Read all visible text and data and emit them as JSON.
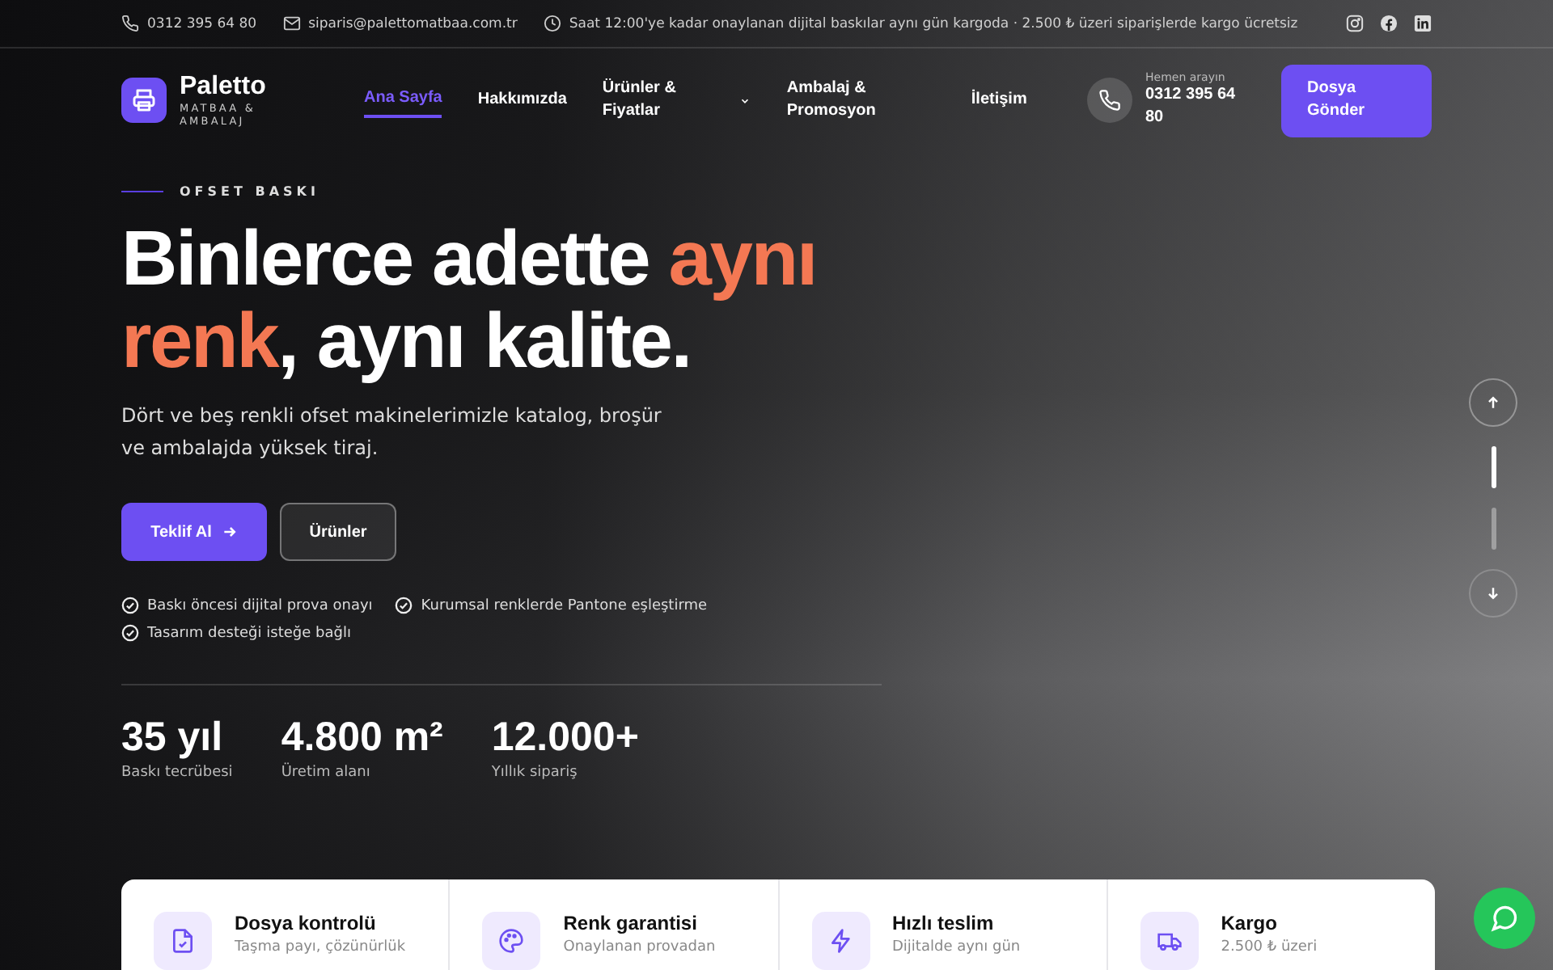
{
  "topbar": {
    "phone": "0312 395 64 80",
    "email": "siparis@palettomatbaa.com.tr",
    "notice": "Saat 12:00'ye kadar onaylanan dijital baskılar aynı gün kargoda · 2.500 ₺ üzeri siparişlerde kargo ücretsiz"
  },
  "brand": {
    "name": "Paletto",
    "tagline": "MATBAA & AMBALAJ"
  },
  "nav": [
    {
      "label": "Ana Sayfa",
      "selected": true,
      "dropdown": false
    },
    {
      "label": "Hakkımızda",
      "selected": false,
      "dropdown": false
    },
    {
      "label": "Ürünler & Fiyatlar",
      "selected": false,
      "dropdown": true
    },
    {
      "label": "Ambalaj & Promosyon",
      "selected": false,
      "dropdown": false
    },
    {
      "label": "İletişim",
      "selected": false,
      "dropdown": false
    }
  ],
  "call": {
    "hint": "Hemen arayın",
    "number": "0312 395 64 80"
  },
  "cta": "Dosya Gönder",
  "hero": {
    "eyebrow": "OFSET BASKI",
    "title": [
      {
        "text": "Binlerce adette ",
        "accent": false
      },
      {
        "text": "aynı renk",
        "accent": true
      },
      {
        "text": ", aynı kalite.",
        "accent": false
      }
    ],
    "lead": "Dört ve beş renkli ofset makinelerimizle katalog, broşür ve ambalajda yüksek tiraj.",
    "primary": "Teklif Al",
    "secondary": "Ürünler",
    "checks": [
      "Baskı öncesi dijital prova onayı",
      "Kurumsal renklerde Pantone eşleştirme",
      "Tasarım desteği isteğe bağlı"
    ]
  },
  "stats": [
    {
      "value": "35 yıl",
      "label": "Baskı tecrübesi"
    },
    {
      "value": "4.800 m²",
      "label": "Üretim alanı"
    },
    {
      "value": "12.000+",
      "label": "Yıllık sipariş"
    }
  ],
  "slides": [
    {
      "selected": true
    },
    {
      "selected": false
    }
  ],
  "features": [
    {
      "kind": "file",
      "title": "Dosya kontrolü",
      "text": "Taşma payı, çözünürlük"
    },
    {
      "kind": "palette",
      "title": "Renk garantisi",
      "text": "Onaylanan provadan"
    },
    {
      "kind": "bolt",
      "title": "Hızlı teslim",
      "text": "Dijitalde aynı gün"
    },
    {
      "kind": "truck",
      "title": "Kargo",
      "text": "2.500 ₺ üzeri"
    }
  ]
}
